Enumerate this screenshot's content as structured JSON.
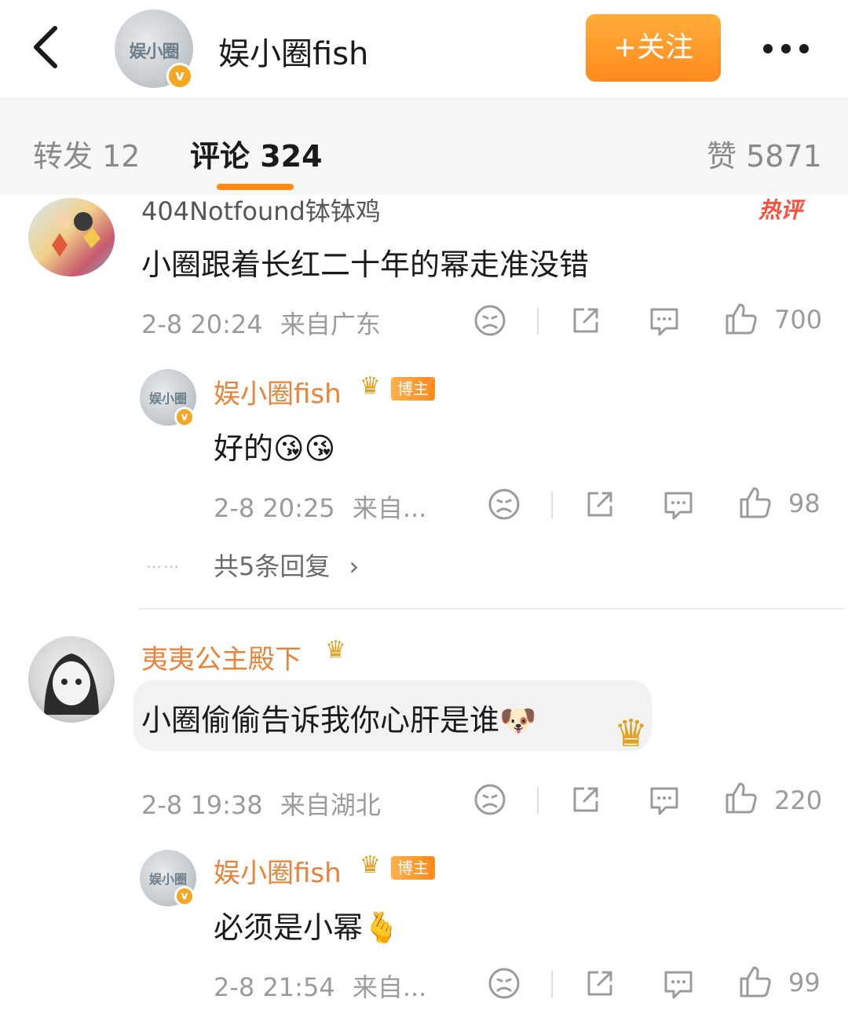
{
  "header": {
    "back_icon": "chevron-left-icon",
    "avatar_logo": "娱小圈",
    "name": "娱小圈fish",
    "follow_label": "+关注",
    "more_icon": "more-dots-icon"
  },
  "tabs": {
    "repost": "转发 12",
    "comment": "评论 324",
    "likes": "赞 5871"
  },
  "comments": [
    {
      "user": "404Notfound钵钵鸡",
      "hot_tag": "热评",
      "text": "小圈跟着长红二十年的幂走准没错",
      "time": "2-8 20:24",
      "location": "来自广东",
      "likes": "700",
      "reply": {
        "user": "娱小圈fish",
        "tag": "博主",
        "text": "好的",
        "emoji": "😘😘",
        "time": "2-8 20:25",
        "location": "来自...",
        "likes": "98"
      },
      "more_replies": "共5条回复",
      "more_dots": "……"
    },
    {
      "user": "夷夷公主殿下",
      "text": "小圈偷偷告诉我你心肝是谁",
      "emoji": "🐶",
      "time": "2-8 19:38",
      "location": "来自湖北",
      "likes": "220",
      "reply": {
        "user": "娱小圈fish",
        "tag": "博主",
        "text": "必须是小幂",
        "emoji": "🫰",
        "time": "2-8 21:54",
        "location": "来自...",
        "likes": "99"
      }
    }
  ],
  "colors": {
    "accent": "#ff8a1c",
    "username": "#e8833a",
    "hot": "#ff4d3a"
  }
}
